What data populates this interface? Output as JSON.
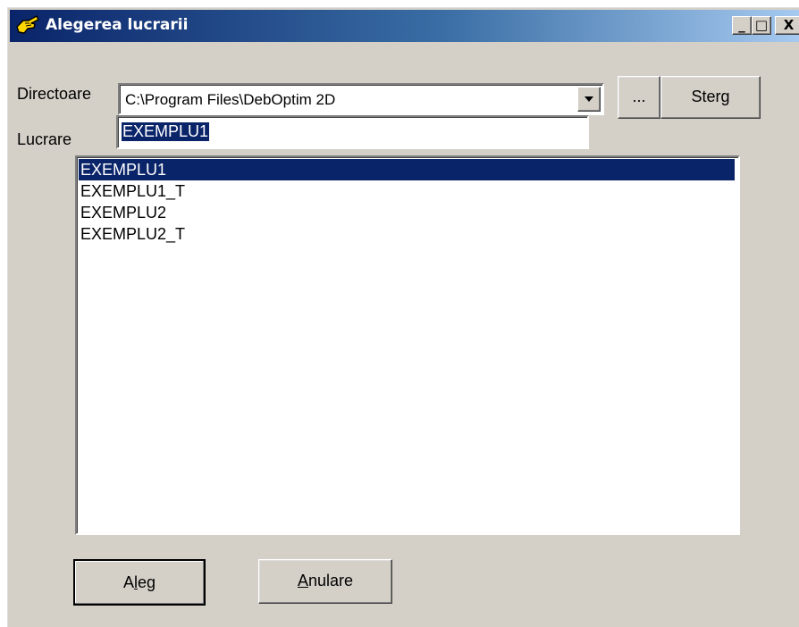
{
  "window": {
    "title": "Alegerea lucrarii",
    "caption_buttons": {
      "minimize": "_",
      "maximize": "□",
      "close": "X"
    }
  },
  "form": {
    "directoare_label": "Directoare",
    "directoare_value": "C:\\Program Files\\DebOptim 2D",
    "browse_label": "...",
    "sterg_label": "Sterg",
    "lucrare_label": "Lucrare",
    "lucrare_value": "EXEMPLU1"
  },
  "list": {
    "items": [
      "EXEMPLU1",
      "EXEMPLU1_T",
      "EXEMPLU2",
      "EXEMPLU2_T"
    ],
    "selected": "EXEMPLU1"
  },
  "footer": {
    "aleg_label": "Aleg",
    "aleg_mnemonic_index": 1,
    "anulare_label": "Anulare",
    "anulare_mnemonic_index": 0
  },
  "colors": {
    "face": "#d4d0c8",
    "selection": "#0a246a",
    "title_start": "#0a246a",
    "title_end": "#a6caf0"
  },
  "icons": {
    "title": "hand-cursor-icon",
    "dropdown": "down-arrow-icon"
  }
}
